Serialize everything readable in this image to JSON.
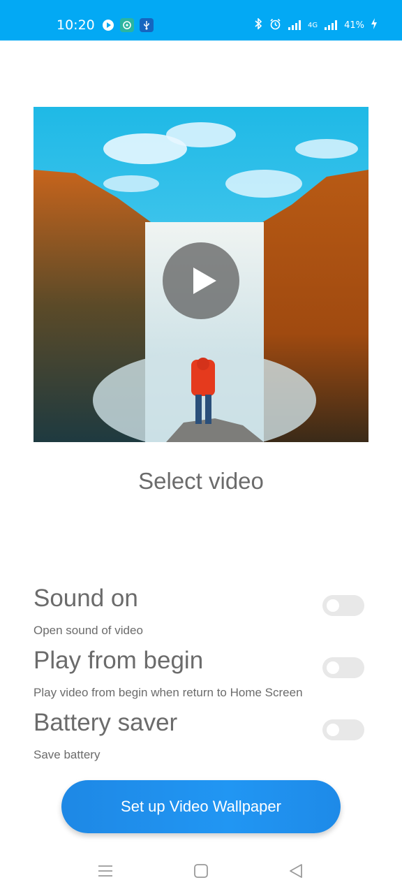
{
  "status_bar": {
    "time": "10:20",
    "network": "4G",
    "battery": "41%",
    "notification_icons": [
      "play-icon",
      "chat-icon",
      "usb-icon"
    ],
    "right_icons": [
      "bluetooth-icon",
      "alarm-icon",
      "signal-icon",
      "battery-charging-icon"
    ]
  },
  "video_preview": {
    "play_icon": "play-icon"
  },
  "select_video_label": "Select video",
  "options": [
    {
      "title": "Sound on",
      "description": "Open sound of video",
      "enabled": false
    },
    {
      "title": "Play from begin",
      "description": "Play video from begin when return to Home Screen",
      "enabled": false
    },
    {
      "title": "Battery saver",
      "description": "Save battery",
      "enabled": false
    }
  ],
  "cta_label": "Set up Video Wallpaper",
  "navbar": {
    "icons": [
      "menu-icon",
      "home-icon",
      "back-icon"
    ]
  },
  "colors": {
    "status_bar": "#03a9f4",
    "primary": "#2196f3",
    "text_gray": "#6b6b6b",
    "toggle_off": "#e8e8e8"
  }
}
